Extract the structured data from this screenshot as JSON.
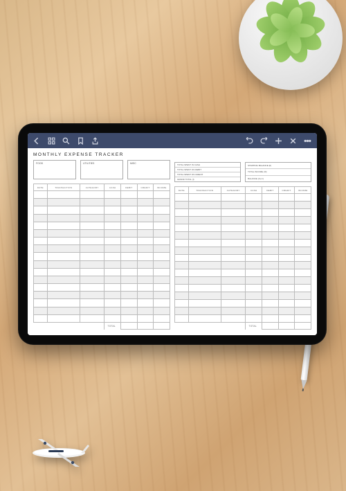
{
  "document": {
    "title": "MONTHLY EXPENSE TRACKER",
    "categories": [
      "FOOD",
      "UTILITIES",
      "MISC"
    ],
    "summaryLeft": [
      "TOTAL SPENT IN CASH",
      "TOTAL SPENT ON DEBIT",
      "TOTAL SPENT ON CREDIT",
      "GRAND TOTAL (I)"
    ],
    "summaryRight": [
      "STARTING BALANCE (II)",
      "TOTAL INCOME (III)",
      "BALANCE (II+I-I)"
    ],
    "columns": [
      "DATE",
      "TRANSACTION",
      "CATEGORY",
      "CASH",
      "DEBIT",
      "CREDIT",
      "INCOME"
    ],
    "totalLabel": "TOTAL",
    "rowCount": 17
  },
  "toolbar": {
    "leftIcons": [
      "back",
      "grid",
      "search",
      "bookmark",
      "share"
    ],
    "rightIcons": [
      "undo",
      "redo",
      "add",
      "close",
      "more"
    ]
  }
}
